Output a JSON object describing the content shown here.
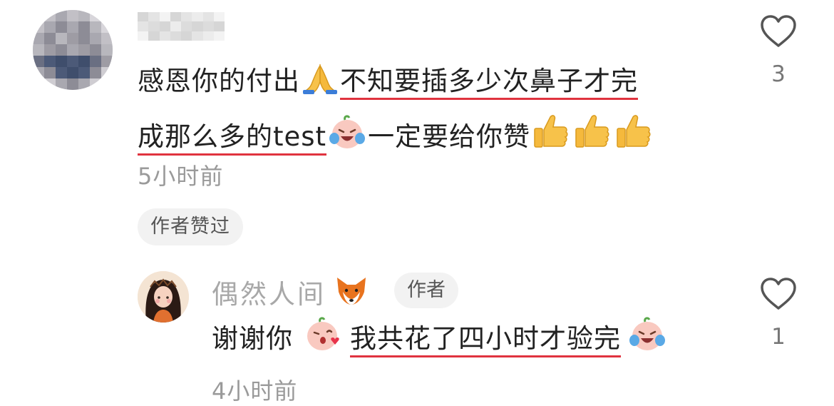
{
  "comment": {
    "text_before": "感恩你的付出",
    "text_highlight_1": "不知要插多少次鼻子才完",
    "text_highlight_2": "成那么多的test",
    "text_after": "一定要给你赞",
    "time": "5小时前",
    "liked_badge": "作者赞过",
    "like_count": "3",
    "emojis": [
      "pray-emoji",
      "crying-laughing-peach-emoji",
      "thumbs-up-emoji",
      "thumbs-up-emoji",
      "thumbs-up-emoji"
    ]
  },
  "reply": {
    "username": "偶然人间",
    "author_badge": "作者",
    "text_before": "谢谢你",
    "text_highlight": "我共花了四小时才验完",
    "time": "4小时前",
    "like_count": "1",
    "emojis": [
      "fox-emoji",
      "kissing-peach-emoji",
      "crying-laughing-peach-emoji"
    ]
  },
  "colors": {
    "highlight_underline": "#e0333f",
    "muted_text": "#9a9a9a",
    "badge_bg": "#f2f2f2"
  }
}
